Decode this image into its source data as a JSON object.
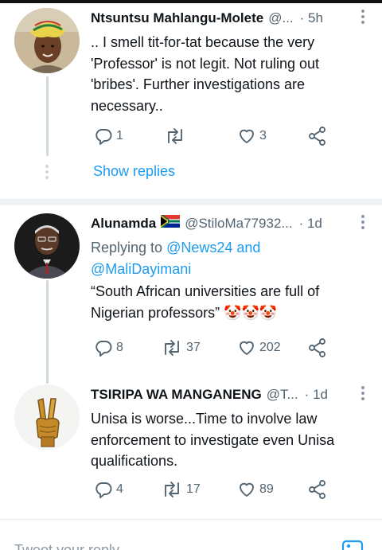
{
  "tweets": [
    {
      "name": "Ntsuntsu Mahlangu-Molete",
      "handle": "@...",
      "time": "· 5h",
      "text": ".. I smell tit-for-tat because the very 'Professor' is not legit. Not ruling out 'bribes'. Further investigations are necessary..",
      "replies": "1",
      "retweets": "",
      "likes": "3",
      "show_replies": "Show replies"
    },
    {
      "name": "Alunamda",
      "flag": "south-africa-flag-icon",
      "handle": "@StiloMa77932...",
      "time": "· 1d",
      "replying_label": "Replying to",
      "replying_mention1": "@News24",
      "replying_and": "and",
      "replying_mention2": "@MaliDayimani",
      "text": "“South African universities are full of Nigerian professors” 🤡🤡🤡",
      "replies": "8",
      "retweets": "37",
      "likes": "202"
    },
    {
      "name": "TSIRIPA WA MANGANENG",
      "handle": "@T...",
      "time": "· 1d",
      "text": "Unisa is worse...Time to involve law enforcement to investigate even Unisa qualifications.",
      "replies": "4",
      "retweets": "17",
      "likes": "89"
    }
  ],
  "composer": {
    "placeholder": "Tweet your reply"
  },
  "colors": {
    "accent": "#1d9bf0",
    "muted": "#536471",
    "thread_line": "#cfd9de"
  }
}
